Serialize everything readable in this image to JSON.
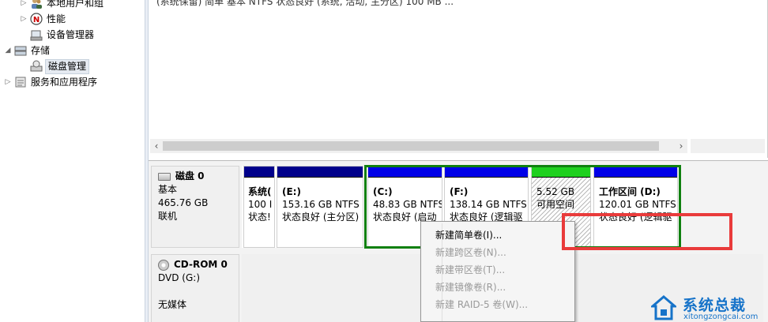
{
  "tree": {
    "items": [
      {
        "label": "本地用户和组",
        "arrow": "▷"
      },
      {
        "label": "性能",
        "arrow": "▷"
      },
      {
        "label": "设备管理器",
        "arrow": ""
      },
      {
        "label": "存储",
        "arrow": "◢"
      },
      {
        "label": "磁盘管理",
        "arrow": ""
      },
      {
        "label": "服务和应用程序",
        "arrow": "▷"
      }
    ]
  },
  "top_pane": {
    "partial_row": "(系统保留)    简单    基本    NTFS    状态良好 (系统, 活动, 主分区)                                  100 MB          ..."
  },
  "disks": [
    {
      "name": "磁盘 0",
      "type": "基本",
      "size": "465.76 GB",
      "status": "联机",
      "partitions": [
        {
          "title": "系统(",
          "line2": "100 I",
          "line3": "状态!"
        },
        {
          "title": "(E:)",
          "line2": "153.16 GB NTFS",
          "line3": "状态良好 (主分区)"
        },
        {
          "title": "(C:)",
          "line2": "48.83 GB NTFS",
          "line3": "状态良好 (启动"
        },
        {
          "title": "(F:)",
          "line2": "138.14 GB NTFS",
          "line3": "状态良好 (逻辑驱"
        },
        {
          "title": "",
          "line2": "5.52 GB",
          "line3": "可用空间"
        },
        {
          "title": "工作区间  (D:)",
          "line2": "120.01 GB NTFS",
          "line3": "状态良好 (逻辑驱"
        }
      ]
    },
    {
      "name": "CD-ROM 0",
      "type": "DVD (G:)",
      "size": "",
      "status": "无媒体"
    }
  ],
  "context_menu": {
    "items": [
      {
        "label": "新建简单卷(I)...",
        "enabled": true
      },
      {
        "label": "新建跨区卷(N)...",
        "enabled": false
      },
      {
        "label": "新建带区卷(T)...",
        "enabled": false
      },
      {
        "label": "新建镜像卷(R)...",
        "enabled": false
      },
      {
        "label": "新建 RAID-5 卷(W)...",
        "enabled": false
      }
    ]
  },
  "watermark": {
    "title": "系统总裁",
    "url": "xitongzongcai.com"
  },
  "colors": {
    "primary_bar": "#00008b",
    "free_space_bar": "#1ed01e",
    "extended_frame": "#108010",
    "annotation": "#e93b3b",
    "watermark": "#1673c9"
  }
}
